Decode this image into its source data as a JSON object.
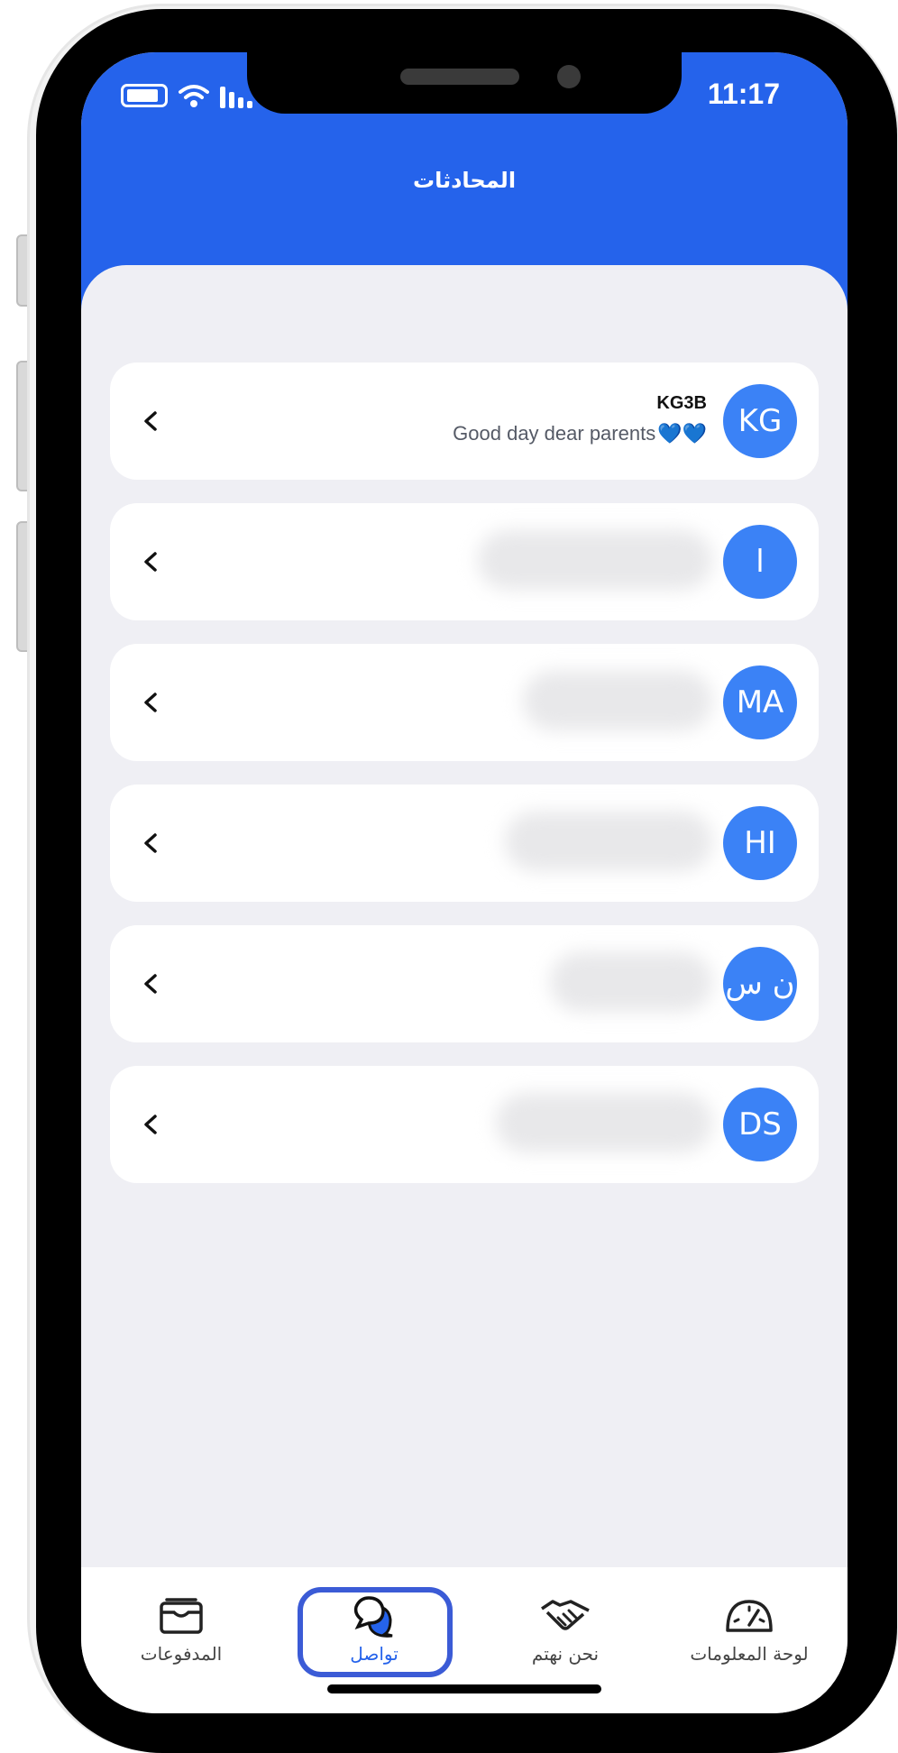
{
  "status_bar": {
    "time": "11:17"
  },
  "header": {
    "title": "المحادثات"
  },
  "chats": [
    {
      "avatar_initials": "KG",
      "name": "KG3B",
      "preview": "Good day dear parents",
      "preview_emoji": "💙💙",
      "blurred": false
    },
    {
      "avatar_initials": "ا",
      "name": "",
      "preview": "",
      "blurred": true
    },
    {
      "avatar_initials": "MA",
      "name": "",
      "preview": "",
      "blurred": true
    },
    {
      "avatar_initials": "HI",
      "name": "",
      "preview": "",
      "blurred": true
    },
    {
      "avatar_initials": "ن س",
      "name": "",
      "preview": "",
      "blurred": true
    },
    {
      "avatar_initials": "DS",
      "name": "",
      "preview": "",
      "blurred": true
    }
  ],
  "bottom_nav": {
    "items": [
      {
        "label": "المدفوعات",
        "icon": "wallet-icon",
        "active": false
      },
      {
        "label": "تواصل",
        "icon": "chat-bubbles-icon",
        "active": true
      },
      {
        "label": "نحن نهتم",
        "icon": "handshake-icon",
        "active": false
      },
      {
        "label": "لوحة المعلومات",
        "icon": "dashboard-gauge-icon",
        "active": false
      }
    ]
  },
  "colors": {
    "primary": "#2563eb",
    "avatar": "#3b82f6",
    "background": "#efeff4",
    "active_ring": "#3b5bd6"
  }
}
